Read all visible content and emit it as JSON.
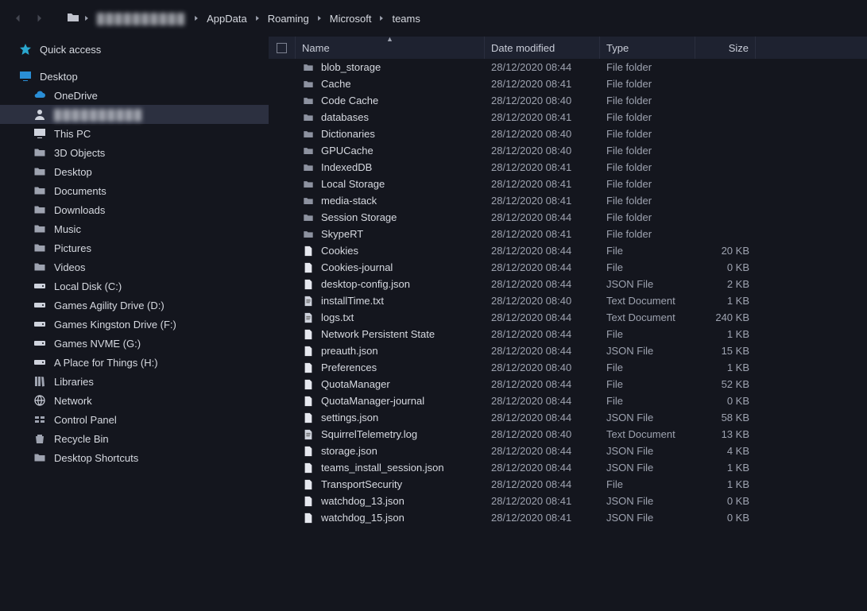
{
  "breadcrumb": {
    "user_blurred": "██████████",
    "items": [
      "AppData",
      "Roaming",
      "Microsoft",
      "teams"
    ]
  },
  "nav": {
    "quick_access": "Quick access",
    "desktop_root": "Desktop",
    "onedrive": "OneDrive",
    "user_blurred": "██████████",
    "this_pc": "This PC",
    "pc_children": [
      {
        "label": "3D Objects"
      },
      {
        "label": "Desktop"
      },
      {
        "label": "Documents"
      },
      {
        "label": "Downloads"
      },
      {
        "label": "Music"
      },
      {
        "label": "Pictures"
      },
      {
        "label": "Videos"
      },
      {
        "label": "Local Disk (C:)"
      },
      {
        "label": "Games Agility Drive (D:)"
      },
      {
        "label": "Games Kingston Drive (F:)"
      },
      {
        "label": "Games NVME (G:)"
      },
      {
        "label": "A Place for Things (H:)"
      }
    ],
    "libraries": "Libraries",
    "network": "Network",
    "control_panel": "Control Panel",
    "recycle_bin": "Recycle Bin",
    "desktop_shortcuts": "Desktop Shortcuts"
  },
  "columns": {
    "name": "Name",
    "date": "Date modified",
    "type": "Type",
    "size": "Size"
  },
  "files": [
    {
      "icon": "folder",
      "name": "blob_storage",
      "date": "28/12/2020 08:44",
      "type": "File folder",
      "size": ""
    },
    {
      "icon": "folder",
      "name": "Cache",
      "date": "28/12/2020 08:41",
      "type": "File folder",
      "size": ""
    },
    {
      "icon": "folder",
      "name": "Code Cache",
      "date": "28/12/2020 08:40",
      "type": "File folder",
      "size": ""
    },
    {
      "icon": "folder",
      "name": "databases",
      "date": "28/12/2020 08:41",
      "type": "File folder",
      "size": ""
    },
    {
      "icon": "folder",
      "name": "Dictionaries",
      "date": "28/12/2020 08:40",
      "type": "File folder",
      "size": ""
    },
    {
      "icon": "folder",
      "name": "GPUCache",
      "date": "28/12/2020 08:40",
      "type": "File folder",
      "size": ""
    },
    {
      "icon": "folder",
      "name": "IndexedDB",
      "date": "28/12/2020 08:41",
      "type": "File folder",
      "size": ""
    },
    {
      "icon": "folder",
      "name": "Local Storage",
      "date": "28/12/2020 08:41",
      "type": "File folder",
      "size": ""
    },
    {
      "icon": "folder",
      "name": "media-stack",
      "date": "28/12/2020 08:41",
      "type": "File folder",
      "size": ""
    },
    {
      "icon": "folder",
      "name": "Session Storage",
      "date": "28/12/2020 08:44",
      "type": "File folder",
      "size": ""
    },
    {
      "icon": "folder",
      "name": "SkypeRT",
      "date": "28/12/2020 08:41",
      "type": "File folder",
      "size": ""
    },
    {
      "icon": "file",
      "name": "Cookies",
      "date": "28/12/2020 08:44",
      "type": "File",
      "size": "20 KB"
    },
    {
      "icon": "file",
      "name": "Cookies-journal",
      "date": "28/12/2020 08:44",
      "type": "File",
      "size": "0 KB"
    },
    {
      "icon": "file",
      "name": "desktop-config.json",
      "date": "28/12/2020 08:44",
      "type": "JSON File",
      "size": "2 KB"
    },
    {
      "icon": "text",
      "name": "installTime.txt",
      "date": "28/12/2020 08:40",
      "type": "Text Document",
      "size": "1 KB"
    },
    {
      "icon": "text",
      "name": "logs.txt",
      "date": "28/12/2020 08:44",
      "type": "Text Document",
      "size": "240 KB"
    },
    {
      "icon": "file",
      "name": "Network Persistent State",
      "date": "28/12/2020 08:44",
      "type": "File",
      "size": "1 KB"
    },
    {
      "icon": "file",
      "name": "preauth.json",
      "date": "28/12/2020 08:44",
      "type": "JSON File",
      "size": "15 KB"
    },
    {
      "icon": "file",
      "name": "Preferences",
      "date": "28/12/2020 08:40",
      "type": "File",
      "size": "1 KB"
    },
    {
      "icon": "file",
      "name": "QuotaManager",
      "date": "28/12/2020 08:44",
      "type": "File",
      "size": "52 KB"
    },
    {
      "icon": "file",
      "name": "QuotaManager-journal",
      "date": "28/12/2020 08:44",
      "type": "File",
      "size": "0 KB"
    },
    {
      "icon": "file",
      "name": "settings.json",
      "date": "28/12/2020 08:44",
      "type": "JSON File",
      "size": "58 KB"
    },
    {
      "icon": "text",
      "name": "SquirrelTelemetry.log",
      "date": "28/12/2020 08:40",
      "type": "Text Document",
      "size": "13 KB"
    },
    {
      "icon": "file",
      "name": "storage.json",
      "date": "28/12/2020 08:44",
      "type": "JSON File",
      "size": "4 KB"
    },
    {
      "icon": "file",
      "name": "teams_install_session.json",
      "date": "28/12/2020 08:44",
      "type": "JSON File",
      "size": "1 KB"
    },
    {
      "icon": "file",
      "name": "TransportSecurity",
      "date": "28/12/2020 08:44",
      "type": "File",
      "size": "1 KB"
    },
    {
      "icon": "file",
      "name": "watchdog_13.json",
      "date": "28/12/2020 08:41",
      "type": "JSON File",
      "size": "0 KB"
    },
    {
      "icon": "file",
      "name": "watchdog_15.json",
      "date": "28/12/2020 08:41",
      "type": "JSON File",
      "size": "0 KB"
    }
  ]
}
